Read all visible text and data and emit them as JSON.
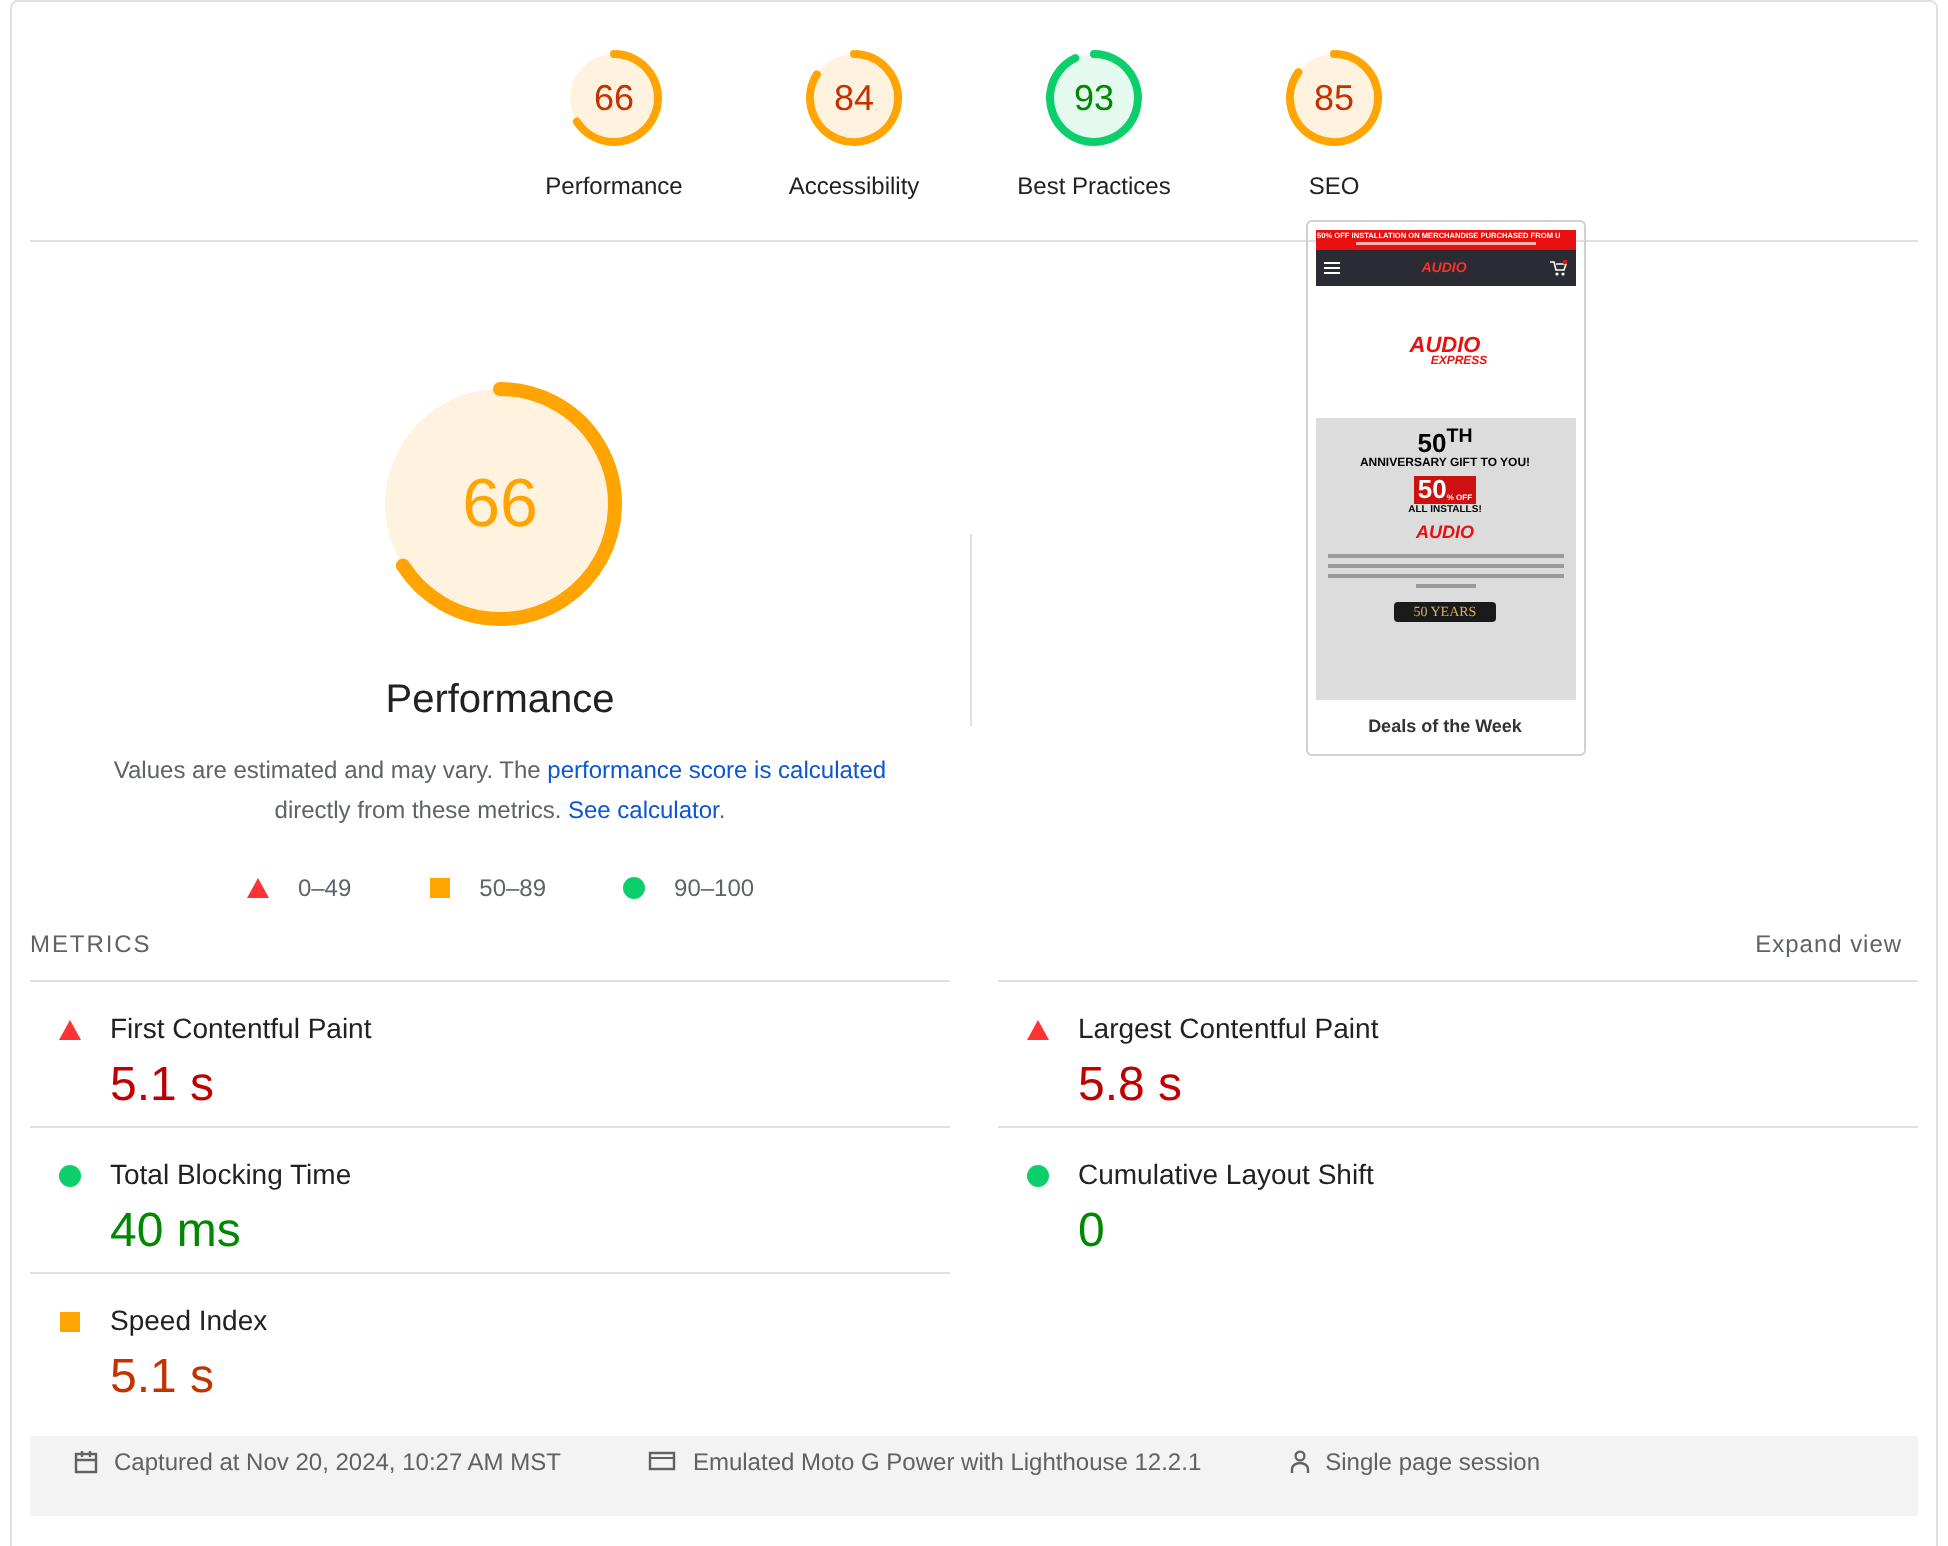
{
  "categories": [
    {
      "label": "Performance",
      "score": "66",
      "kind": "average"
    },
    {
      "label": "Accessibility",
      "score": "84",
      "kind": "average"
    },
    {
      "label": "Best Practices",
      "score": "93",
      "kind": "pass"
    },
    {
      "label": "SEO",
      "score": "85",
      "kind": "average"
    }
  ],
  "main_gauge": {
    "score": "66",
    "label": "Performance",
    "kind": "average"
  },
  "description": [
    {
      "kind": "text",
      "text": "Values are estimated and may vary. The "
    },
    {
      "kind": "link",
      "text": "performance score is calculated"
    },
    {
      "kind": "text",
      "text": " directly from these metrics. "
    },
    {
      "kind": "link",
      "text": "See calculator"
    },
    {
      "kind": "text",
      "text": "."
    }
  ],
  "legend": [
    {
      "kind": "fail",
      "label": "0–49"
    },
    {
      "kind": "average",
      "label": "50–89"
    },
    {
      "kind": "pass",
      "label": "90–100"
    }
  ],
  "screenshot": {
    "banner": "50% OFF INSTALLATION ON MERCHANDISE PURCHASED FROM U",
    "logo_header": "AUDIO",
    "logo_main": "AUDIO",
    "logo_main_sub": "EXPRESS",
    "heading": "50$^{TH}$",
    "subheading": "ANNIVERSARY GIFT TO YOU!",
    "badge_number": "50",
    "badge_unit": "% OFF",
    "installs": "ALL INSTALLS!",
    "logo_promo": "AUDIO",
    "ribbon": "50 YEARS",
    "deals": "Deals of the Week"
  },
  "metrics": {
    "title": "METRICS",
    "toggle": "Expand view",
    "items": [
      {
        "name": "First Contentful Paint",
        "value": "5.1 s",
        "kind": "fail"
      },
      {
        "name": "Largest Contentful Paint",
        "value": "5.8 s",
        "kind": "fail"
      },
      {
        "name": "Total Blocking Time",
        "value": "40 ms",
        "kind": "pass"
      },
      {
        "name": "Cumulative Layout Shift",
        "value": "0",
        "kind": "pass"
      },
      {
        "name": "Speed Index",
        "value": "5.1 s",
        "kind": "average"
      }
    ]
  },
  "footer": [
    {
      "kind": "calendar",
      "text": "Captured at Nov 20, 2024, 10:27 AM MST"
    },
    {
      "kind": "device",
      "text": "Emulated Moto G Power with Lighthouse 12.2.1"
    },
    {
      "kind": "person",
      "text": "Single page session"
    }
  ]
}
